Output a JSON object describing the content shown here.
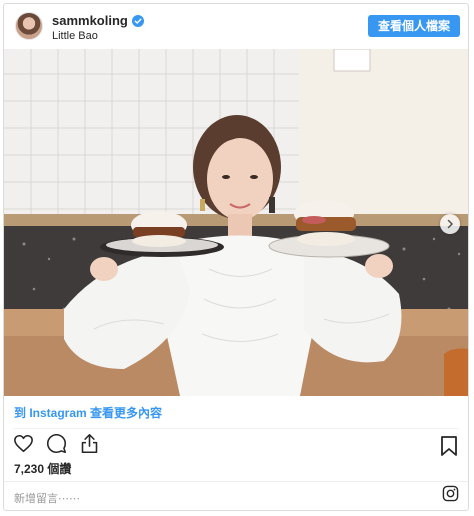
{
  "header": {
    "username": "sammkoling",
    "location": "Little Bao",
    "profile_button": "查看個人檔案"
  },
  "post": {
    "view_more": "到 Instagram 查看更多內容",
    "likes": "7,230 個讚",
    "comment_placeholder": "新增留言⋯⋯"
  },
  "icons": {
    "verified": "verified-badge-icon",
    "like": "heart-icon",
    "comment": "comment-bubble-icon",
    "share": "share-icon",
    "save": "bookmark-icon",
    "instagram": "instagram-logo-icon",
    "next": "chevron-right-icon"
  },
  "colors": {
    "accent": "#3897f0",
    "text": "#262626",
    "muted": "#999999",
    "border": "#dbdbdb"
  }
}
